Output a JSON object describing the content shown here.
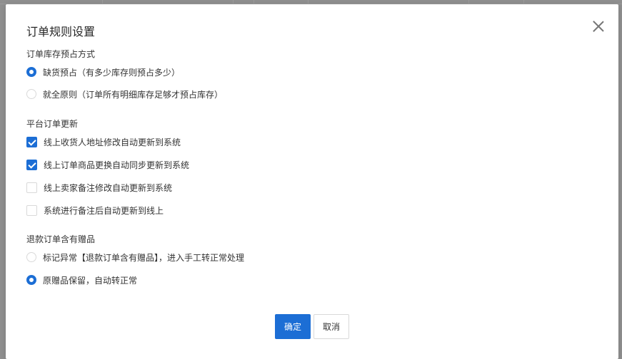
{
  "background": {
    "footer_text": ""
  },
  "dialog": {
    "title": "订单规则设置",
    "close_icon": "close-icon",
    "sections": [
      {
        "label": "订单库存预占方式",
        "options": [
          {
            "label": "缺货预占（有多少库存则预占多少）",
            "checked": true
          },
          {
            "label": "就全原则（订单所有明细库存足够才预占库存）",
            "checked": false
          }
        ]
      },
      {
        "label": "平台订单更新",
        "options": [
          {
            "label": "线上收货人地址修改自动更新到系统",
            "checked": true
          },
          {
            "label": "线上订单商品更换自动同步更新到系统",
            "checked": true
          },
          {
            "label": "线上卖家备注修改自动更新到系统",
            "checked": false
          },
          {
            "label": "系统进行备注后自动更新到线上",
            "checked": false
          }
        ]
      },
      {
        "label": "退款订单含有赠品",
        "options": [
          {
            "label": "标记异常【退款订单含有赠品】，进入手工转正常处理",
            "checked": false
          },
          {
            "label": "原赠品保留，自动转正常",
            "checked": true
          }
        ]
      }
    ],
    "buttons": {
      "ok": "确定",
      "cancel": "取消"
    },
    "accent_color": "#1c6ed5"
  }
}
